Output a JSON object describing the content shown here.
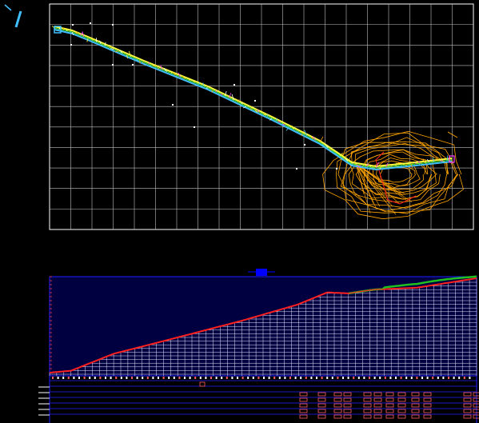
{
  "colors": {
    "background": "#000000",
    "plan_grid": "#ffffff",
    "profile_frame": "#2020ff",
    "profile_grid": "#ffffff",
    "ground_line": "#ff2020",
    "design_line": "#20c020",
    "contours": "#ffa500",
    "alignment_accent": "#ff40ff",
    "alignment_cyan": "#40c0ff",
    "band_text": "#ff6060",
    "title_block": "#0000ff"
  },
  "icons": {
    "north_arrow": "north-arrow-icon",
    "profile_title_tag": "title-block-icon"
  },
  "profile": {
    "ground_line_fraction_by_station": [
      [
        0.0,
        0.0
      ],
      [
        0.05,
        0.02
      ],
      [
        0.15,
        0.2
      ],
      [
        0.28,
        0.35
      ],
      [
        0.45,
        0.55
      ],
      [
        0.58,
        0.72
      ],
      [
        0.65,
        0.85
      ],
      [
        0.7,
        0.84
      ],
      [
        0.76,
        0.88
      ],
      [
        0.86,
        0.9
      ],
      [
        1.0,
        1.0
      ]
    ]
  }
}
